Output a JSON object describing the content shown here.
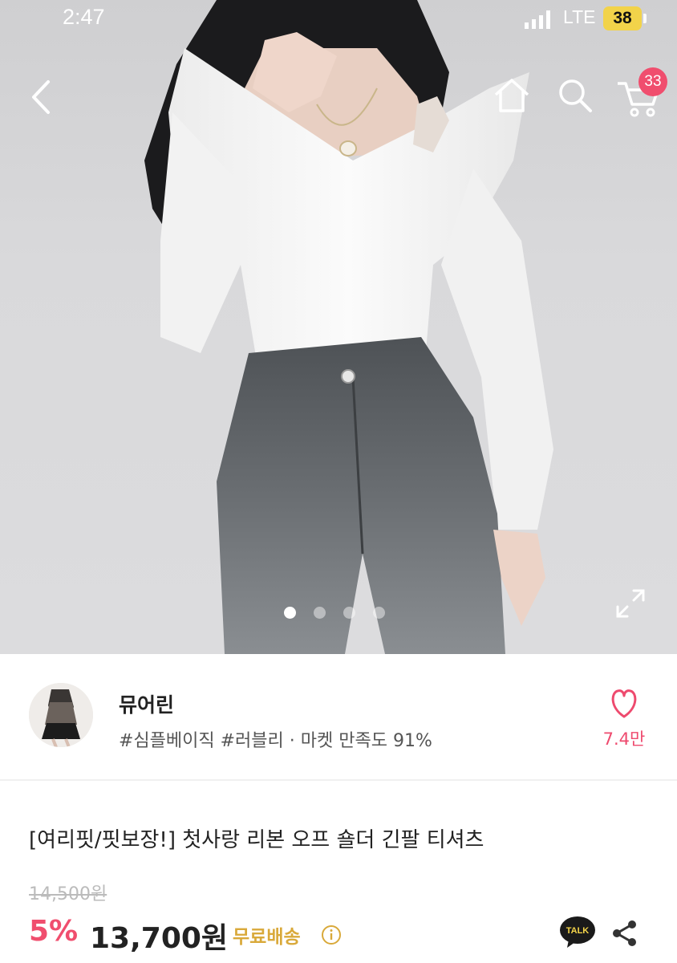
{
  "status_bar": {
    "time": "2:47",
    "network": "LTE",
    "battery": "38"
  },
  "header": {
    "cart_count": "33"
  },
  "icons": {
    "back": "chevron-left-icon",
    "home": "home-icon",
    "search": "search-icon",
    "cart": "cart-icon",
    "expand": "expand-icon",
    "like": "heart-icon",
    "info": "info-icon",
    "talk": "kakaotalk-icon",
    "share": "share-icon"
  },
  "gallery": {
    "pages": 4,
    "active_page": 1
  },
  "seller": {
    "name": "뮤어린",
    "tags": "#심플베이직 #러블리 · 마켓 만족도 91%",
    "likes": "7.4만"
  },
  "product": {
    "title": "[여리핏/핏보장!] 첫사랑 리본 오프 숄더 긴팔 티셔츠",
    "original_price": "14,500원",
    "discount": "5%",
    "sale_price": "13,700원",
    "shipping": "무료배송",
    "talk_label": "TALK"
  },
  "colors": {
    "accent": "#f04e6e",
    "shipping": "#d9a93a",
    "battery": "#f2d34a"
  }
}
